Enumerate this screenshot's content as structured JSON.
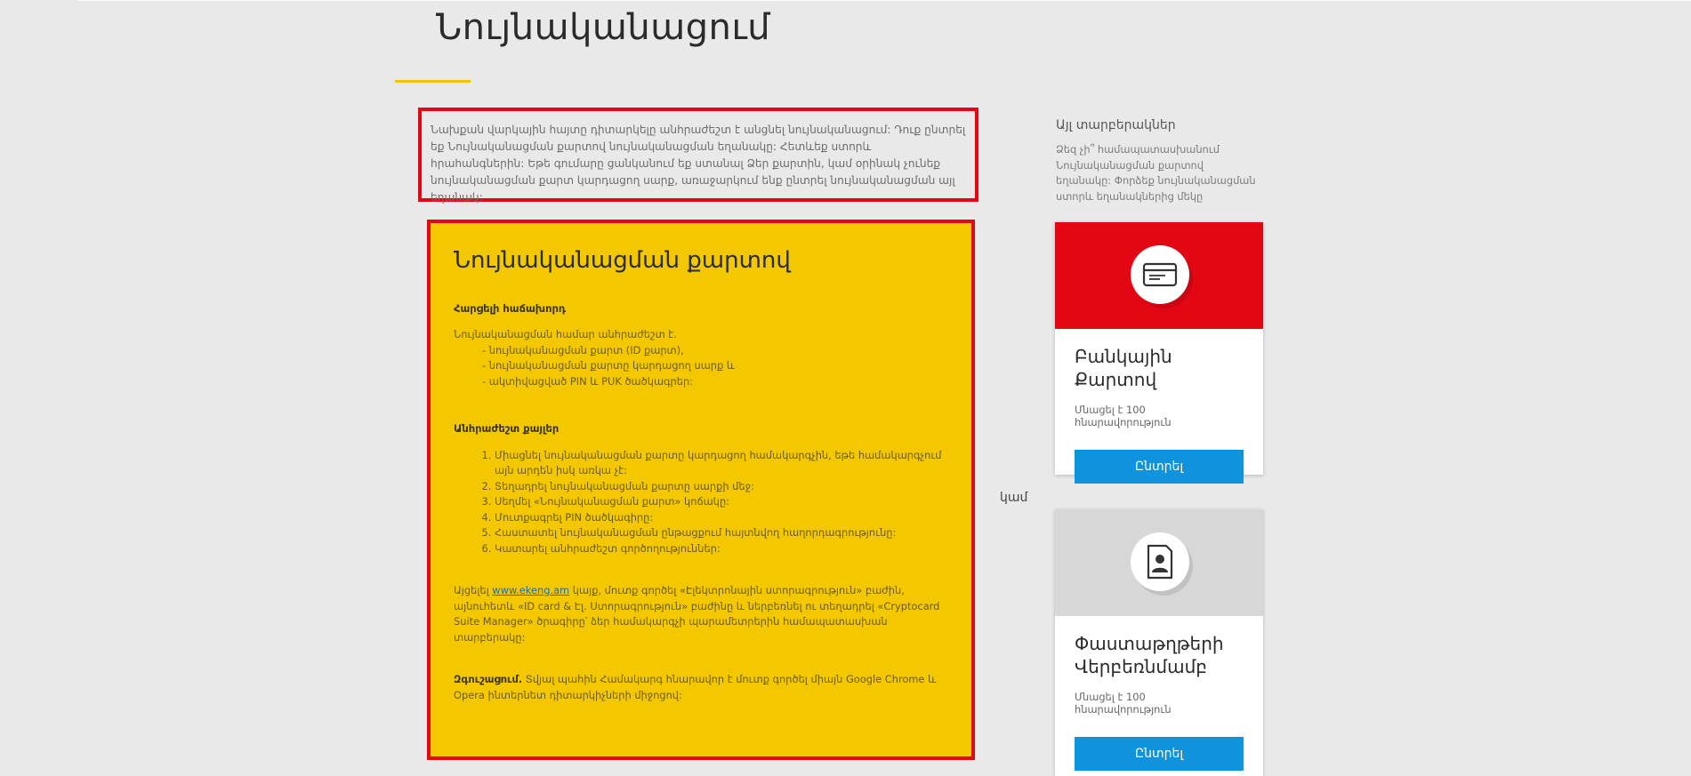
{
  "page": {
    "title": "Նույնականացում",
    "intro": "Նախքան վարկային հայտը դիտարկելը անհրաժեշտ է անցնել նույնականացում: Դուք ընտրել եք Նույնականացման քարտով նույնականացման եղանակը: Հետևեք ստորև հրահանգներին: Եթե գումարը ցանկանում եք ստանալ Ձեր քարտին, կամ օրինակ չունեք նույնականացման քարտ կարդացող սարք, առաջարկում ենք ընտրել նույնականացման այլ եղանակ:"
  },
  "id_card": {
    "title": "Նույնականացման քարտով",
    "faq_heading": "Հարցելի հաճախորդ",
    "requirements_intro": "Նույնականացման համար անհրաժեշտ է.",
    "requirements": [
      "- նույնականացման քարտ (ID քարտ),",
      "- նույնականացման քարտը կարդացող սարք և",
      "- ակտիվացված PIN և PUK ծածկագրեր:"
    ],
    "steps_heading": "Անհրաժեշտ քայլեր",
    "steps": [
      "Միացնել նույնականացման քարտը կարդացող համակարգչին, եթե համակարգչում այն արդեն իսկ առկա չէ:",
      "Տեղադրել նույնականացման քարտը սարքի մեջ:",
      "Սեղմել «Նույնականացման քարտ» կոճակը:",
      "Մուտքագրել PIN ծածկագիրը:",
      "Հաստատել նույնականացման ընթացքում հայտնվող հաղորդագրությունը:",
      "Կատարել անհրաժեշտ գործողություններ:"
    ],
    "visit_prefix": "Այցելել",
    "visit_link": "www.ekeng.am",
    "visit_suffix": "կայք, մուտք գործել «Էլեկտրոնային ստորագրություն» բաժին, այնուհետև «ID card & Էլ. Ստորագրություն» բաժինը և ներբեռնել ու տեղադրել «Cryptocard Suite Manager» ծրագիրը՝ ձեր համակարգչի պարամետրերին համապատասխան տարբերակը:",
    "warning_label": "Զգուշացում.",
    "warning_text": "Տվյալ պահին Համակարգ հնարավոր է մուտք գործել միայն Google Chrome և Opera ինտերնետ դիտարկիչների միջոցով:"
  },
  "sidebar": {
    "title": "Այլ տարբերակներ",
    "description": "Ձեզ չի՞ համապատասխանում Նույնականացման քարտով եղանակը: Փորձեք նույնականացման ստորև եղանակներից մեկը",
    "or_label": "կամ",
    "options": [
      {
        "title": "Բանկային Քարտով",
        "note": "Մնացել է 100 հնարավորություն",
        "button": "Ընտրել",
        "icon": "credit-card-icon",
        "color": "#e30613"
      },
      {
        "title": "Փաստաթղթերի Վերբեռնմամբ",
        "note": "Մնացել է 100 հնարավորություն",
        "button": "Ընտրել",
        "icon": "id-document-icon",
        "color": "#d7d7d7"
      }
    ]
  },
  "colors": {
    "accent_yellow": "#f4c800",
    "highlight_red": "#e30613",
    "button_blue": "#0f93dc"
  }
}
